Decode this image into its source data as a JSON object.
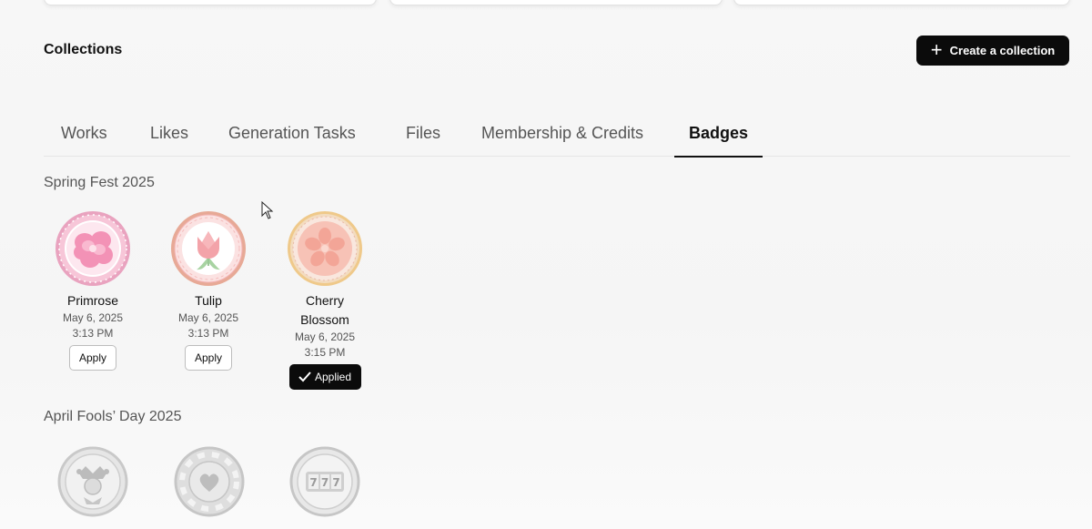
{
  "header": {
    "title": "Collections",
    "create_button_label": "Create a collection",
    "create_button_icon": "plus-icon"
  },
  "tabs": [
    {
      "label": "Works",
      "active": false
    },
    {
      "label": "Likes",
      "active": false
    },
    {
      "label": "Generation Tasks",
      "active": false
    },
    {
      "label": "Files",
      "active": false
    },
    {
      "label": "Membership & Credits",
      "active": false
    },
    {
      "label": "Badges",
      "active": true
    }
  ],
  "groups": [
    {
      "title": "Spring Fest 2025",
      "badges": [
        {
          "name": "Primrose",
          "date": "May 6, 2025",
          "time": "3:13 PM",
          "action": "Apply",
          "icon": "primrose-badge-icon",
          "color": "#f4a9c6"
        },
        {
          "name": "Tulip",
          "date": "May 6, 2025",
          "time": "3:13 PM",
          "action": "Apply",
          "icon": "tulip-badge-icon",
          "color": "#f2b6a8"
        },
        {
          "name": "Cherry\nBlossom",
          "date": "May 6, 2025",
          "time": "3:15 PM",
          "action": "Applied",
          "icon": "cherry-blossom-badge-icon",
          "color": "#f6c3b4"
        }
      ]
    },
    {
      "title": "April Fools’ Day 2025",
      "badges": [
        {
          "icon": "jester-badge-icon",
          "locked": true
        },
        {
          "icon": "poker-chip-heart-badge-icon",
          "locked": true
        },
        {
          "icon": "slot-777-badge-icon",
          "locked": true
        }
      ]
    }
  ],
  "colors": {
    "accent": "#0b0b0b",
    "muted_text": "#555555",
    "pink": "#f4a9c6",
    "gold": "#e8c486",
    "locked": "#bdbdbd"
  }
}
